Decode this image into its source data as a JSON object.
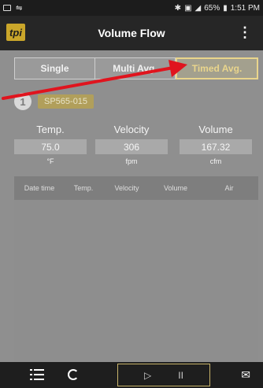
{
  "status_bar": {
    "battery": "65%",
    "time": "1:51 PM"
  },
  "app_bar": {
    "logo": "tpi",
    "title": "Volume Flow",
    "menu_glyph": "⋮"
  },
  "tabs": [
    {
      "label": "Single",
      "active": false
    },
    {
      "label": "Multi Avg.",
      "active": false
    },
    {
      "label": "Timed Avg.",
      "active": true
    }
  ],
  "probe": {
    "icon_text": "1",
    "id": "SP565-015"
  },
  "readings": [
    {
      "label": "Temp.",
      "value": "75.0",
      "unit": "°F"
    },
    {
      "label": "Velocity",
      "value": "306",
      "unit": "fpm"
    },
    {
      "label": "Volume",
      "value": "167.32",
      "unit": "cfm"
    }
  ],
  "table": {
    "headers": [
      "Date time",
      "Temp.",
      "Velocity",
      "Volume",
      "Air"
    ],
    "rows": []
  },
  "bottom_bar": {
    "play_glyph": "▷",
    "pause_glyph": "II",
    "mail_glyph": "✉"
  },
  "colors": {
    "accent": "#e9d58c",
    "annotation_arrow": "#e0141e"
  }
}
